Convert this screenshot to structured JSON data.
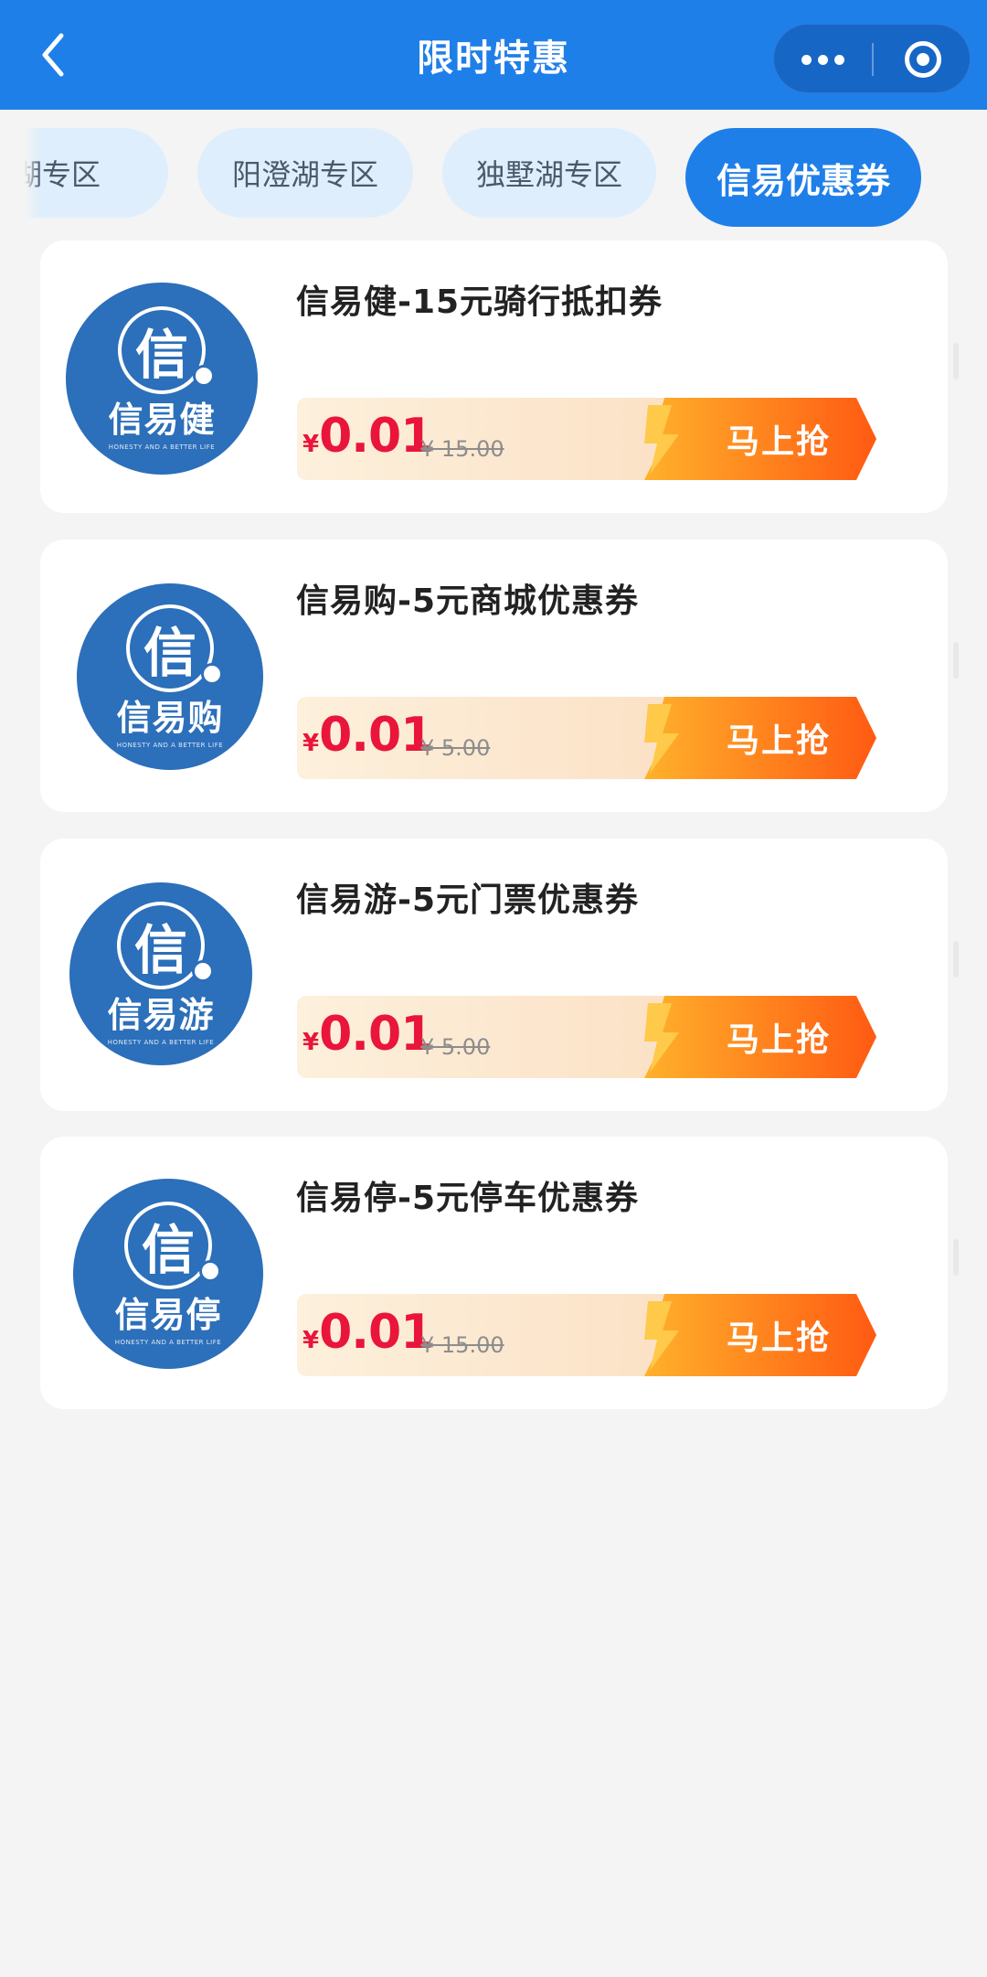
{
  "navbar": {
    "title": "限时特惠",
    "back_icon": "chevron-left-icon",
    "more_icon": "more-dots-icon",
    "close_icon": "target-circle-icon",
    "color": "#1f7fe8"
  },
  "tabs": [
    {
      "label": "湖专区",
      "active": false
    },
    {
      "label": "阳澄湖专区",
      "active": false
    },
    {
      "label": "独墅湖专区",
      "active": false
    },
    {
      "label": "信易优惠券",
      "active": true
    }
  ],
  "coupons": [
    {
      "logo_text": "信易健",
      "title": "信易健-15元骑行抵扣券",
      "currency": "¥",
      "price": "0.01",
      "original_price": "¥ 15.00",
      "button": "马上抢"
    },
    {
      "logo_text": "信易购",
      "title": "信易购-5元商城优惠券",
      "currency": "¥",
      "price": "0.01",
      "original_price": "¥ 5.00",
      "button": "马上抢"
    },
    {
      "logo_text": "信易游",
      "title": "信易游-5元门票优惠券",
      "currency": "¥",
      "price": "0.01",
      "original_price": "¥ 5.00",
      "button": "马上抢"
    },
    {
      "logo_text": "信易停",
      "title": "信易停-5元停车优惠券",
      "currency": "¥",
      "price": "0.01",
      "original_price": "¥ 15.00",
      "button": "马上抢"
    }
  ],
  "colors": {
    "accent": "#1f7fe8",
    "price": "#e9153b",
    "button_start": "#ff9a1f",
    "button_end": "#ff5a12",
    "logo_bg": "#2c6fba"
  }
}
